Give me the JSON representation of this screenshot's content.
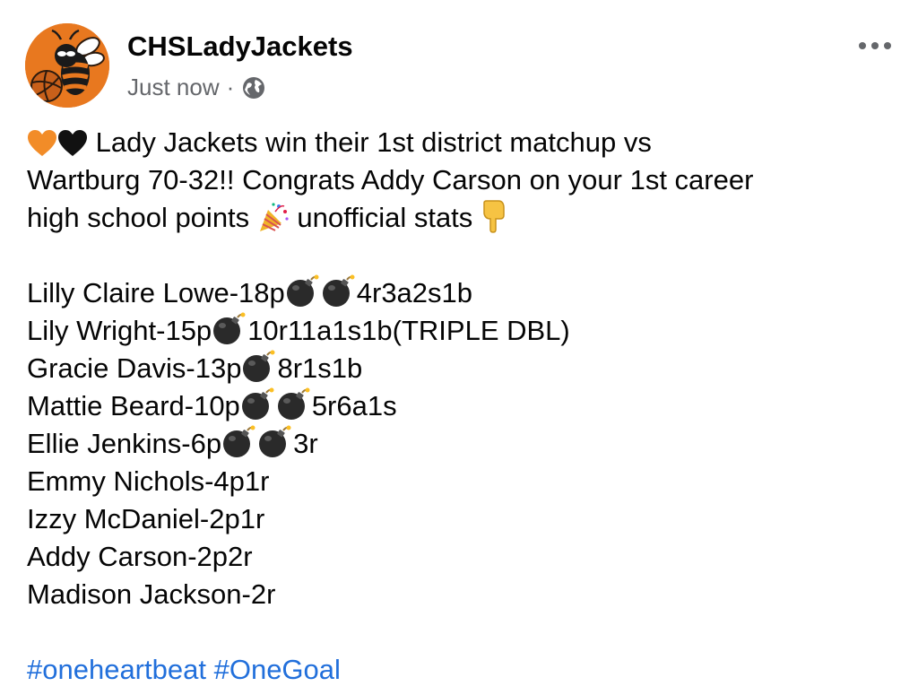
{
  "post": {
    "author": "CHSLadyJackets",
    "timestamp": "Just now",
    "separator": "·",
    "privacy_icon": "globe-icon",
    "more_icon": "more-options-icon",
    "intro": [
      {
        "pre_icons": [
          "orange-heart-emoji",
          "black-heart-emoji"
        ],
        "text": "Lady Jackets win their 1st district matchup vs"
      },
      {
        "text": "Wartburg 70-32!! Congrats Addy Carson on your 1st career"
      },
      {
        "text_a": "high school points",
        "icon_a": "party-popper-emoji",
        "text_b": "unofficial stats",
        "icon_b": "pointing-down-emoji"
      }
    ],
    "stats": [
      {
        "name": "Lilly Claire Lowe-18p",
        "bombs": 2,
        "rest": "4r3a2s1b"
      },
      {
        "name": "Lily Wright-15p",
        "bombs": 1,
        "rest": "10r11a1s1b(TRIPLE DBL)"
      },
      {
        "name": "Gracie Davis-13p",
        "bombs": 1,
        "rest": "8r1s1b"
      },
      {
        "name": "Mattie Beard-10p",
        "bombs": 2,
        "rest": "5r6a1s"
      },
      {
        "name": "Ellie Jenkins-6p",
        "bombs": 2,
        "rest": "3r"
      },
      {
        "name": "Emmy Nichols-4p1r",
        "bombs": 0,
        "rest": ""
      },
      {
        "name": "Izzy McDaniel-2p1r",
        "bombs": 0,
        "rest": ""
      },
      {
        "name": "Addy Carson-2p2r",
        "bombs": 0,
        "rest": ""
      },
      {
        "name": "Madison Jackson-2r",
        "bombs": 0,
        "rest": ""
      }
    ],
    "hashtags": [
      "#oneheartbeat",
      "#OneGoal"
    ]
  },
  "colors": {
    "avatar_bg": "#e8781f",
    "meta": "#65676b",
    "hashtag": "#216fdb",
    "orange_heart": "#f28c28",
    "black_heart": "#111111"
  }
}
